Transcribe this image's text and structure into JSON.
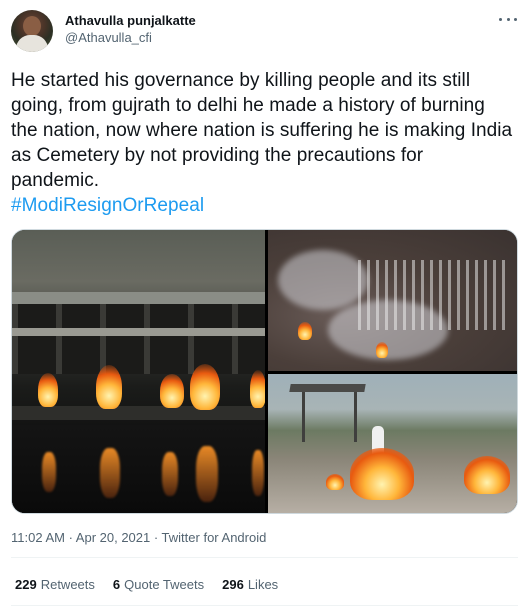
{
  "author": {
    "display_name": "Athavulla punjalkatte",
    "handle": "@Athavulla_cfi",
    "avatar_icon": "profile-photo"
  },
  "tweet": {
    "text": "He started his governance by killing people and its still going, from gujrath to delhi he made a history of burning the nation, now where nation is suffering he is making India as Cemetery by not providing the precautions for pandemic.",
    "hashtag": "#ModiResignOrRepeal"
  },
  "media": {
    "images": [
      "photo-cremation-ghat-night",
      "photo-cremation-ground-aerial",
      "photo-cremation-ground-person"
    ]
  },
  "meta": {
    "timestamp": "11:02 AM · Apr 20, 2021 · Twitter for Android"
  },
  "stats": {
    "retweets_count": "229",
    "retweets_label": "Retweets",
    "quotes_count": "6",
    "quotes_label": "Quote Tweets",
    "likes_count": "296",
    "likes_label": "Likes"
  },
  "colors": {
    "link": "#1d9bf0",
    "secondary_text": "#536471",
    "primary_text": "#0f1419"
  }
}
